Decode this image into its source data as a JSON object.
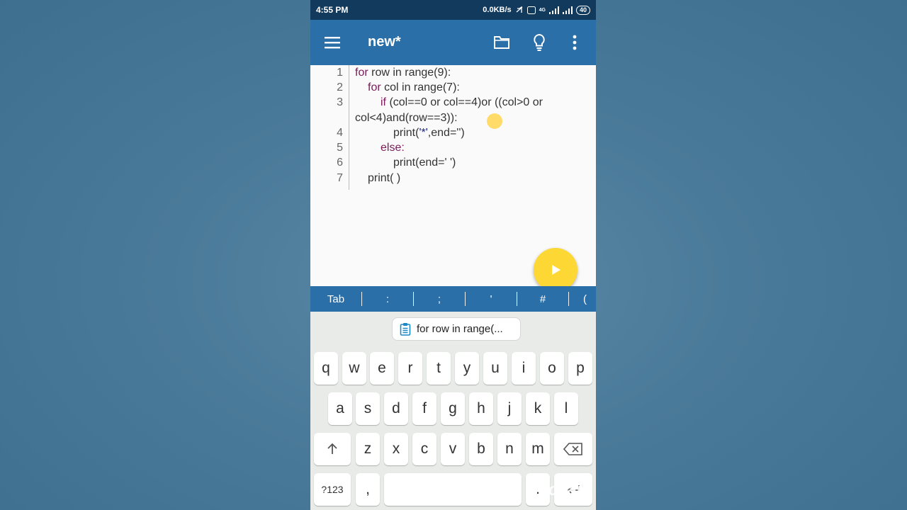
{
  "status": {
    "time": "4:55 PM",
    "speed": "0.0KB/s",
    "network": "4G",
    "battery": "40"
  },
  "app": {
    "title": "new*"
  },
  "code": {
    "line_numbers": [
      "1",
      "2",
      "3",
      "4",
      "5",
      "6",
      "7"
    ],
    "l1": {
      "kw": "for",
      "rest": " row in range(9):"
    },
    "l2": {
      "kw": "for",
      "rest": " col in range(7):"
    },
    "l3a": {
      "kw": "if",
      "rest": " (col==0 or col==4)or ((col>0 or"
    },
    "l3b": {
      "rest": "col<4)and(row==3)):"
    },
    "l4": {
      "pre": "print(",
      "str": "'*'",
      "post": ",end='')"
    },
    "l5": {
      "kw": "else:"
    },
    "l6": {
      "rest": "print(end=' ')"
    },
    "l7": {
      "rest": "print( )"
    }
  },
  "symbols": [
    "Tab",
    ":",
    ";",
    "'",
    "#",
    "("
  ],
  "suggestion": "for row in range(...",
  "keyboard": {
    "row1": [
      "q",
      "w",
      "e",
      "r",
      "t",
      "y",
      "u",
      "i",
      "o",
      "p"
    ],
    "row2": [
      "a",
      "s",
      "d",
      "f",
      "g",
      "h",
      "j",
      "k",
      "l"
    ],
    "row3": [
      "z",
      "x",
      "c",
      "v",
      "b",
      "n",
      "m"
    ],
    "numbers_label": "?123",
    "comma": ",",
    "period": "."
  },
  "watermark": "Picsart"
}
